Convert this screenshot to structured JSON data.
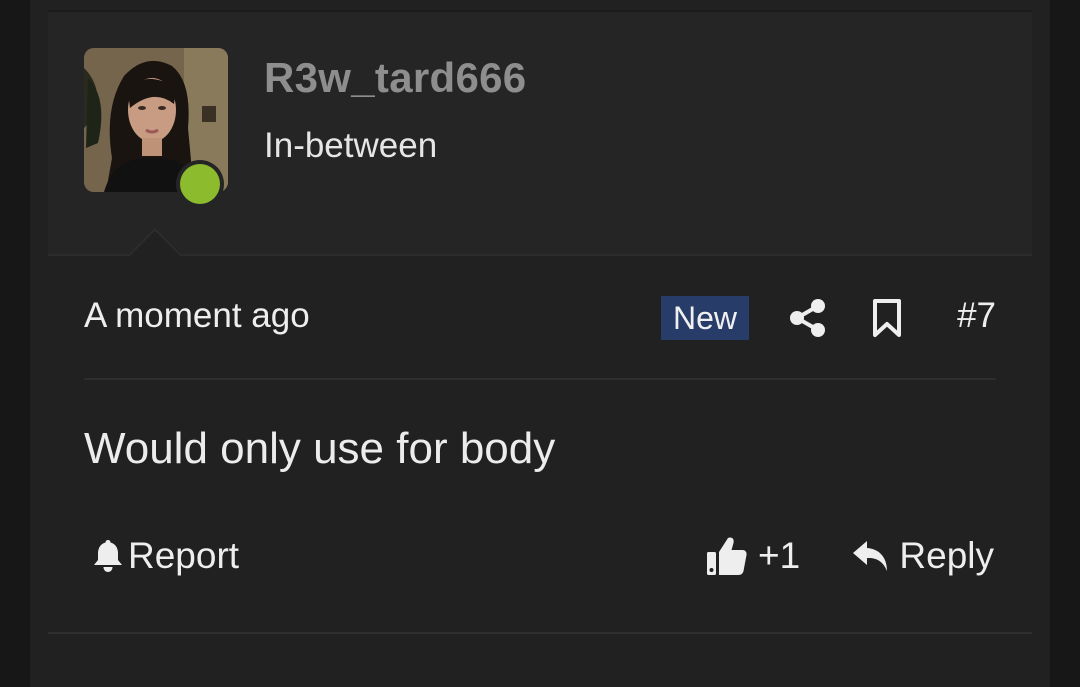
{
  "user": {
    "name": "R3w_tard666",
    "title": "In-between",
    "avatar_icon": "user-avatar-photo",
    "status": "online",
    "status_color": "#8dbb2e"
  },
  "meta": {
    "timestamp": "A moment ago",
    "badge": "New",
    "badge_color": "#283c6a",
    "share_icon": "share-icon",
    "bookmark_icon": "bookmark-icon",
    "post_number": "#7"
  },
  "post": {
    "body": "Would only use for body"
  },
  "actions": {
    "report_icon": "bell-icon",
    "report_label": "Report",
    "like_icon": "thumbs-up-icon",
    "like_count": "+1",
    "reply_icon": "reply-arrow-icon",
    "reply_label": "Reply"
  },
  "colors": {
    "background": "#212121",
    "header": "#252525",
    "text": "#eeeeee",
    "username": "#8e8e8e"
  }
}
